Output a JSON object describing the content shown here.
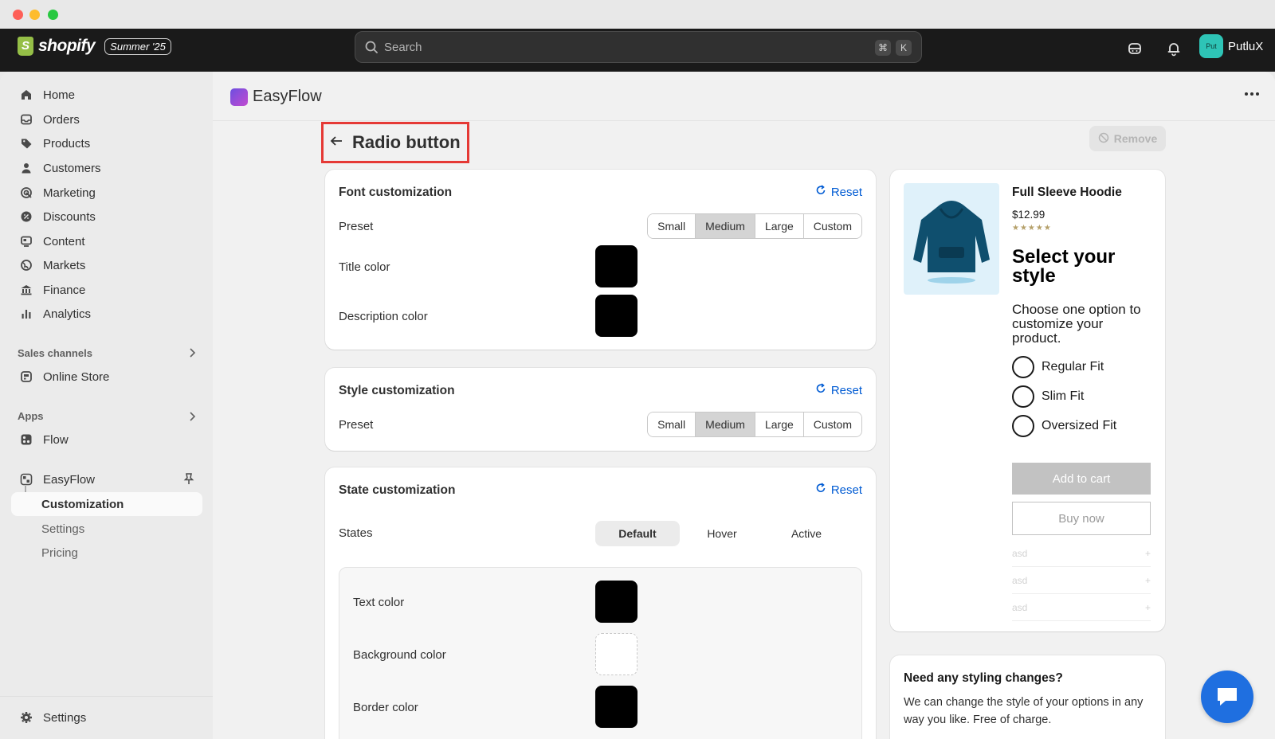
{
  "topbar": {
    "brand": "shopify",
    "edition": "Summer '25",
    "search_placeholder": "Search",
    "shortcut_cmd": "⌘",
    "shortcut_key": "K",
    "avatar_initials": "Put",
    "username": "PutluX"
  },
  "sidebar": {
    "items": [
      {
        "label": "Home",
        "icon": "home-icon"
      },
      {
        "label": "Orders",
        "icon": "inbox-icon"
      },
      {
        "label": "Products",
        "icon": "tag-icon"
      },
      {
        "label": "Customers",
        "icon": "person-icon"
      },
      {
        "label": "Marketing",
        "icon": "target-icon"
      },
      {
        "label": "Discounts",
        "icon": "discount-icon"
      },
      {
        "label": "Content",
        "icon": "content-icon"
      },
      {
        "label": "Markets",
        "icon": "globe-icon"
      },
      {
        "label": "Finance",
        "icon": "bank-icon"
      },
      {
        "label": "Analytics",
        "icon": "bar-chart-icon"
      }
    ],
    "sales_channels_label": "Sales channels",
    "online_store": "Online Store",
    "apps_label": "Apps",
    "flow": "Flow",
    "easyflow": "EasyFlow",
    "sub_items": {
      "customization": "Customization",
      "settings": "Settings",
      "pricing": "Pricing"
    },
    "bottom_settings": "Settings"
  },
  "app": {
    "name": "EasyFlow",
    "page_title": "Radio button",
    "remove_label": "Remove"
  },
  "font_card": {
    "title": "Font customization",
    "reset": "Reset",
    "preset_label": "Preset",
    "presets": [
      "Small",
      "Medium",
      "Large",
      "Custom"
    ],
    "title_color_label": "Title color",
    "description_color_label": "Description color"
  },
  "style_card": {
    "title": "Style customization",
    "reset": "Reset",
    "preset_label": "Preset",
    "presets": [
      "Small",
      "Medium",
      "Large",
      "Custom"
    ]
  },
  "state_card": {
    "title": "State customization",
    "reset": "Reset",
    "states_label": "States",
    "states": [
      "Default",
      "Hover",
      "Active"
    ],
    "text_color_label": "Text color",
    "background_color_label": "Background color",
    "border_color_label": "Border color"
  },
  "preview": {
    "product_name": "Full Sleeve Hoodie",
    "price": "$12.99",
    "stars": "★★★★★",
    "heading": "Select your style",
    "description": "Choose one option to customize your product.",
    "options": [
      "Regular Fit",
      "Slim Fit",
      "Oversized Fit"
    ],
    "add_to_cart": "Add to cart",
    "buy_now": "Buy now",
    "accordion": [
      "asd",
      "asd",
      "asd"
    ],
    "accordion_plus": "+"
  },
  "help_card": {
    "title": "Need any styling changes?",
    "text": "We can change the style of your options in any way you like. Free of charge."
  },
  "colors": {
    "accent": "#005bd3",
    "highlight_border": "#e53935",
    "swatch_black": "#000000",
    "swatch_white": "#ffffff",
    "chat": "#1f6fe0"
  }
}
